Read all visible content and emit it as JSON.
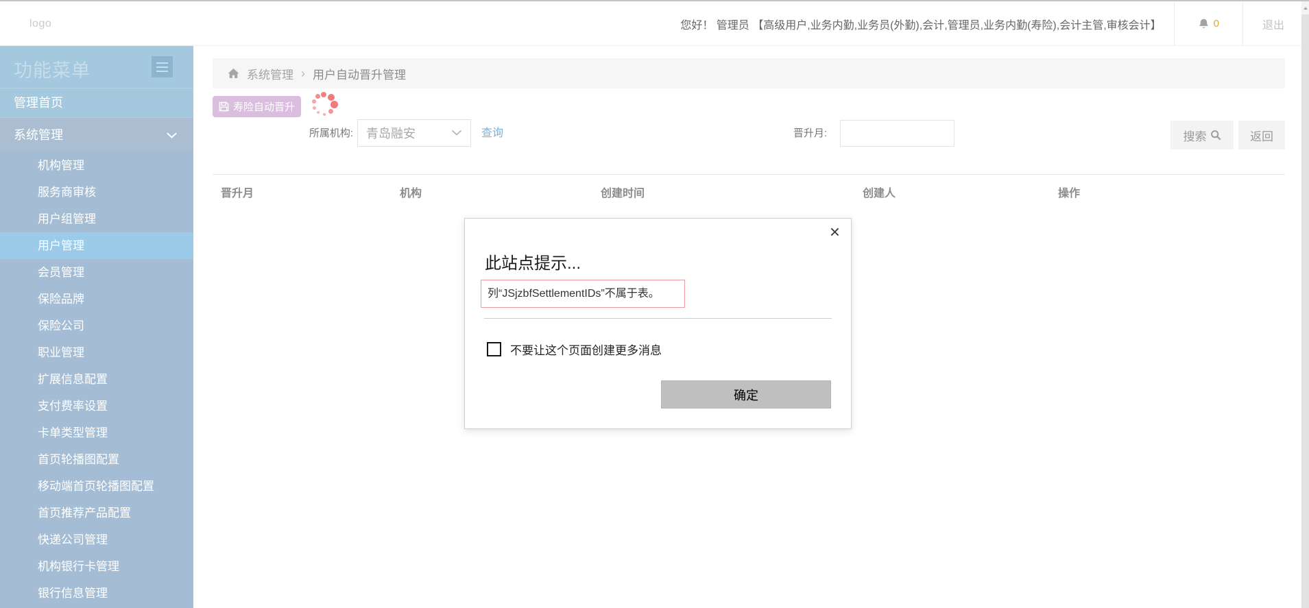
{
  "header": {
    "logo": "logo",
    "greeting": "您好！ 管理员 【高级用户,业务内勤,业务员(外勤),会计,管理员,业务内勤(寿险),会计主管,审核会计】",
    "bell_count": "0",
    "logout": "退出"
  },
  "sidebar": {
    "title": "功能菜单",
    "home_item": "管理首页",
    "group_label": "系统管理",
    "items": [
      {
        "label": "机构管理",
        "active": false
      },
      {
        "label": "服务商审核",
        "active": false
      },
      {
        "label": "用户组管理",
        "active": false
      },
      {
        "label": "用户管理",
        "active": true
      },
      {
        "label": "会员管理",
        "active": false
      },
      {
        "label": "保险品牌",
        "active": false
      },
      {
        "label": "保险公司",
        "active": false
      },
      {
        "label": "职业管理",
        "active": false
      },
      {
        "label": "扩展信息配置",
        "active": false
      },
      {
        "label": "支付费率设置",
        "active": false
      },
      {
        "label": "卡单类型管理",
        "active": false
      },
      {
        "label": "首页轮播图配置",
        "active": false
      },
      {
        "label": "移动端首页轮播图配置",
        "active": false
      },
      {
        "label": "首页推荐产品配置",
        "active": false
      },
      {
        "label": "快递公司管理",
        "active": false
      },
      {
        "label": "机构银行卡管理",
        "active": false
      },
      {
        "label": "银行信息管理",
        "active": false
      }
    ]
  },
  "breadcrumb": {
    "section": "系统管理",
    "separator": "›",
    "page": "用户自动晋升管理"
  },
  "toolbar": {
    "save_button": "寿险自动晋升"
  },
  "filters": {
    "org_label": "所属机构:",
    "org_value": "青岛融安",
    "query_link": "查询",
    "month_label": "晋升月:",
    "month_value": "",
    "search_button": "搜索",
    "back_button": "返回"
  },
  "table": {
    "columns": [
      "晋升月",
      "机构",
      "创建时间",
      "创建人",
      "操作"
    ],
    "rows": []
  },
  "dialog": {
    "title": "此站点提示...",
    "message": "列“JSjzbfSettlementIDs”不属于表。",
    "checkbox_label": "不要让这个页面创建更多消息",
    "checkbox_checked": false,
    "ok_button": "确定",
    "close_glyph": "×"
  },
  "colors": {
    "sidebar_base": "#a5bdd4",
    "sidebar_top": "#a4c8dd",
    "sidebar_group": "#aabdd1",
    "sidebar_active": "#9bcbe9",
    "save_button": "#d9bede",
    "spinner": "#f17a7a",
    "link_blue": "#7db1d8",
    "bell_count": "#e8a33d",
    "error_border": "#e99a9a",
    "ok_button_bg": "#bfbfbf"
  }
}
